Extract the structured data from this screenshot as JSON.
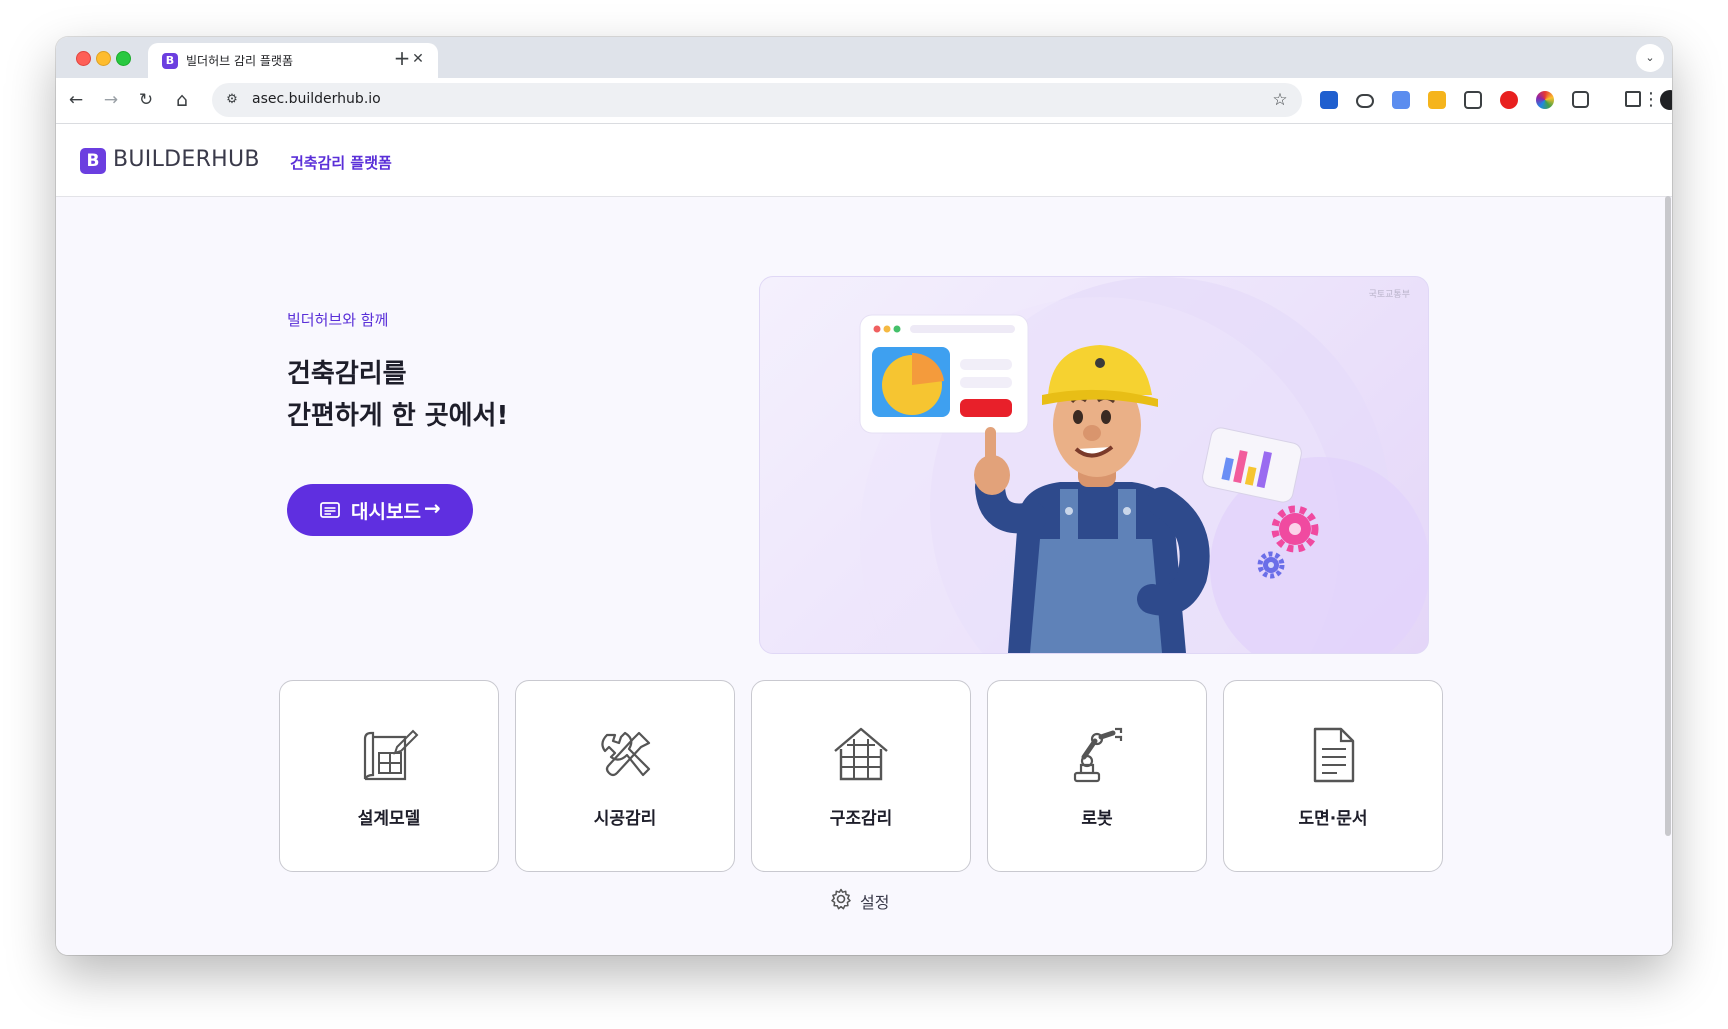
{
  "browser": {
    "tab": {
      "title": "빌더허브 감리 플랫폼",
      "favicon_letter": "B",
      "close": "✕"
    },
    "new_tab": "+",
    "tab_menu": "⌄",
    "nav": {
      "back": "←",
      "forward": "→",
      "reload": "↻",
      "home": "⌂"
    },
    "url": "asec.builderhub.io",
    "site_info_icon": "⚙",
    "bookmark_star": "☆",
    "menu": "⋮"
  },
  "site": {
    "logo_letter": "B",
    "brand": "BUILDERHUB",
    "header_nav": "건축감리 플랫폼"
  },
  "hero": {
    "subtitle": "빌더허브와 함께",
    "title_line1": "건축감리를",
    "title_line2": "간편하게 한 곳에서!",
    "cta_label": "대시보드",
    "cta_arrow": "→",
    "seal_text": "국토교통부"
  },
  "categories": [
    {
      "label": "설계모델",
      "icon": "blueprint-icon"
    },
    {
      "label": "시공감리",
      "icon": "tools-icon"
    },
    {
      "label": "구조감리",
      "icon": "structure-icon"
    },
    {
      "label": "로봇",
      "icon": "robot-arm-icon"
    },
    {
      "label": "도면·문서",
      "icon": "document-icon"
    }
  ],
  "settings": {
    "label": "설정",
    "icon": "gear-icon"
  },
  "colors": {
    "brand": "#6b3ee0",
    "cta": "#5f2fe0",
    "accent_text": "#5a2fd8",
    "page_bg": "#f9f8fe"
  }
}
